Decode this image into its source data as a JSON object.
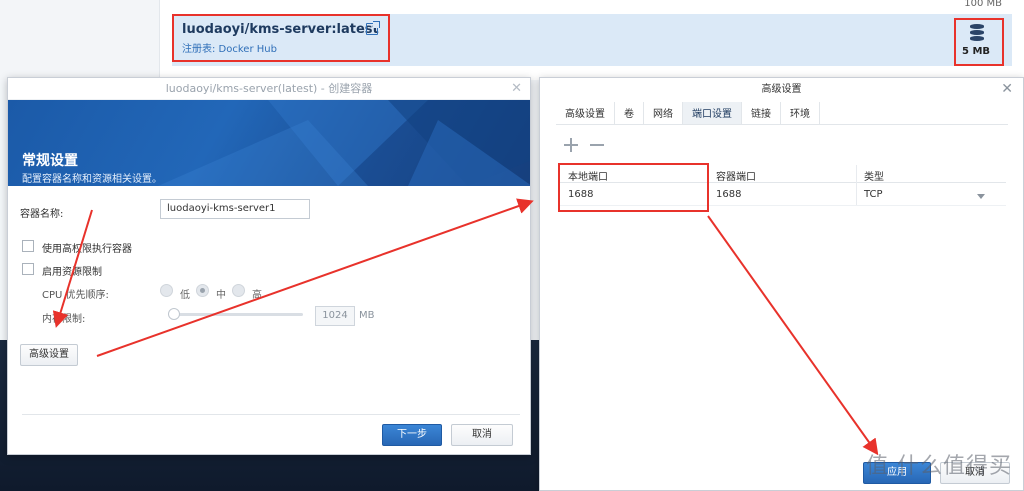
{
  "registry": {
    "top_text": "100 MB",
    "image_name": "luodaoyi/kms-server:latest",
    "registry_label": "注册表: Docker Hub",
    "size": "5 MB",
    "icons": {
      "link": "external-link-icon",
      "size": "database-icon"
    }
  },
  "create_dialog": {
    "title": "luodaoyi/kms-server(latest) - 创建容器",
    "banner_title": "常规设置",
    "banner_subtitle": "配置容器名称和资源相关设置。",
    "container_name_label": "容器名称:",
    "container_name_value": "luodaoyi-kms-server1",
    "privileged_label": "使用高权限执行容器",
    "resource_limit_label": "启用资源限制",
    "cpu_priority_label": "CPU 优先顺序:",
    "cpu_options": [
      "低",
      "中",
      "高"
    ],
    "cpu_selected": "中",
    "memory_limit_label": "内存限制:",
    "memory_value": "1024",
    "memory_unit": "MB",
    "advanced_button": "高级设置",
    "next_button": "下一步",
    "cancel_button": "取消"
  },
  "advanced_dialog": {
    "title": "高级设置",
    "tabs": [
      "高级设置",
      "卷",
      "网络",
      "端口设置",
      "链接",
      "环境"
    ],
    "active_tab": "端口设置",
    "columns": [
      "本地端口",
      "容器端口",
      "类型"
    ],
    "rows": [
      {
        "local_port": "1688",
        "container_port": "1688",
        "type": "TCP"
      }
    ],
    "apply_button": "应用",
    "cancel_button": "取消"
  },
  "watermark": "值 什么值得买"
}
